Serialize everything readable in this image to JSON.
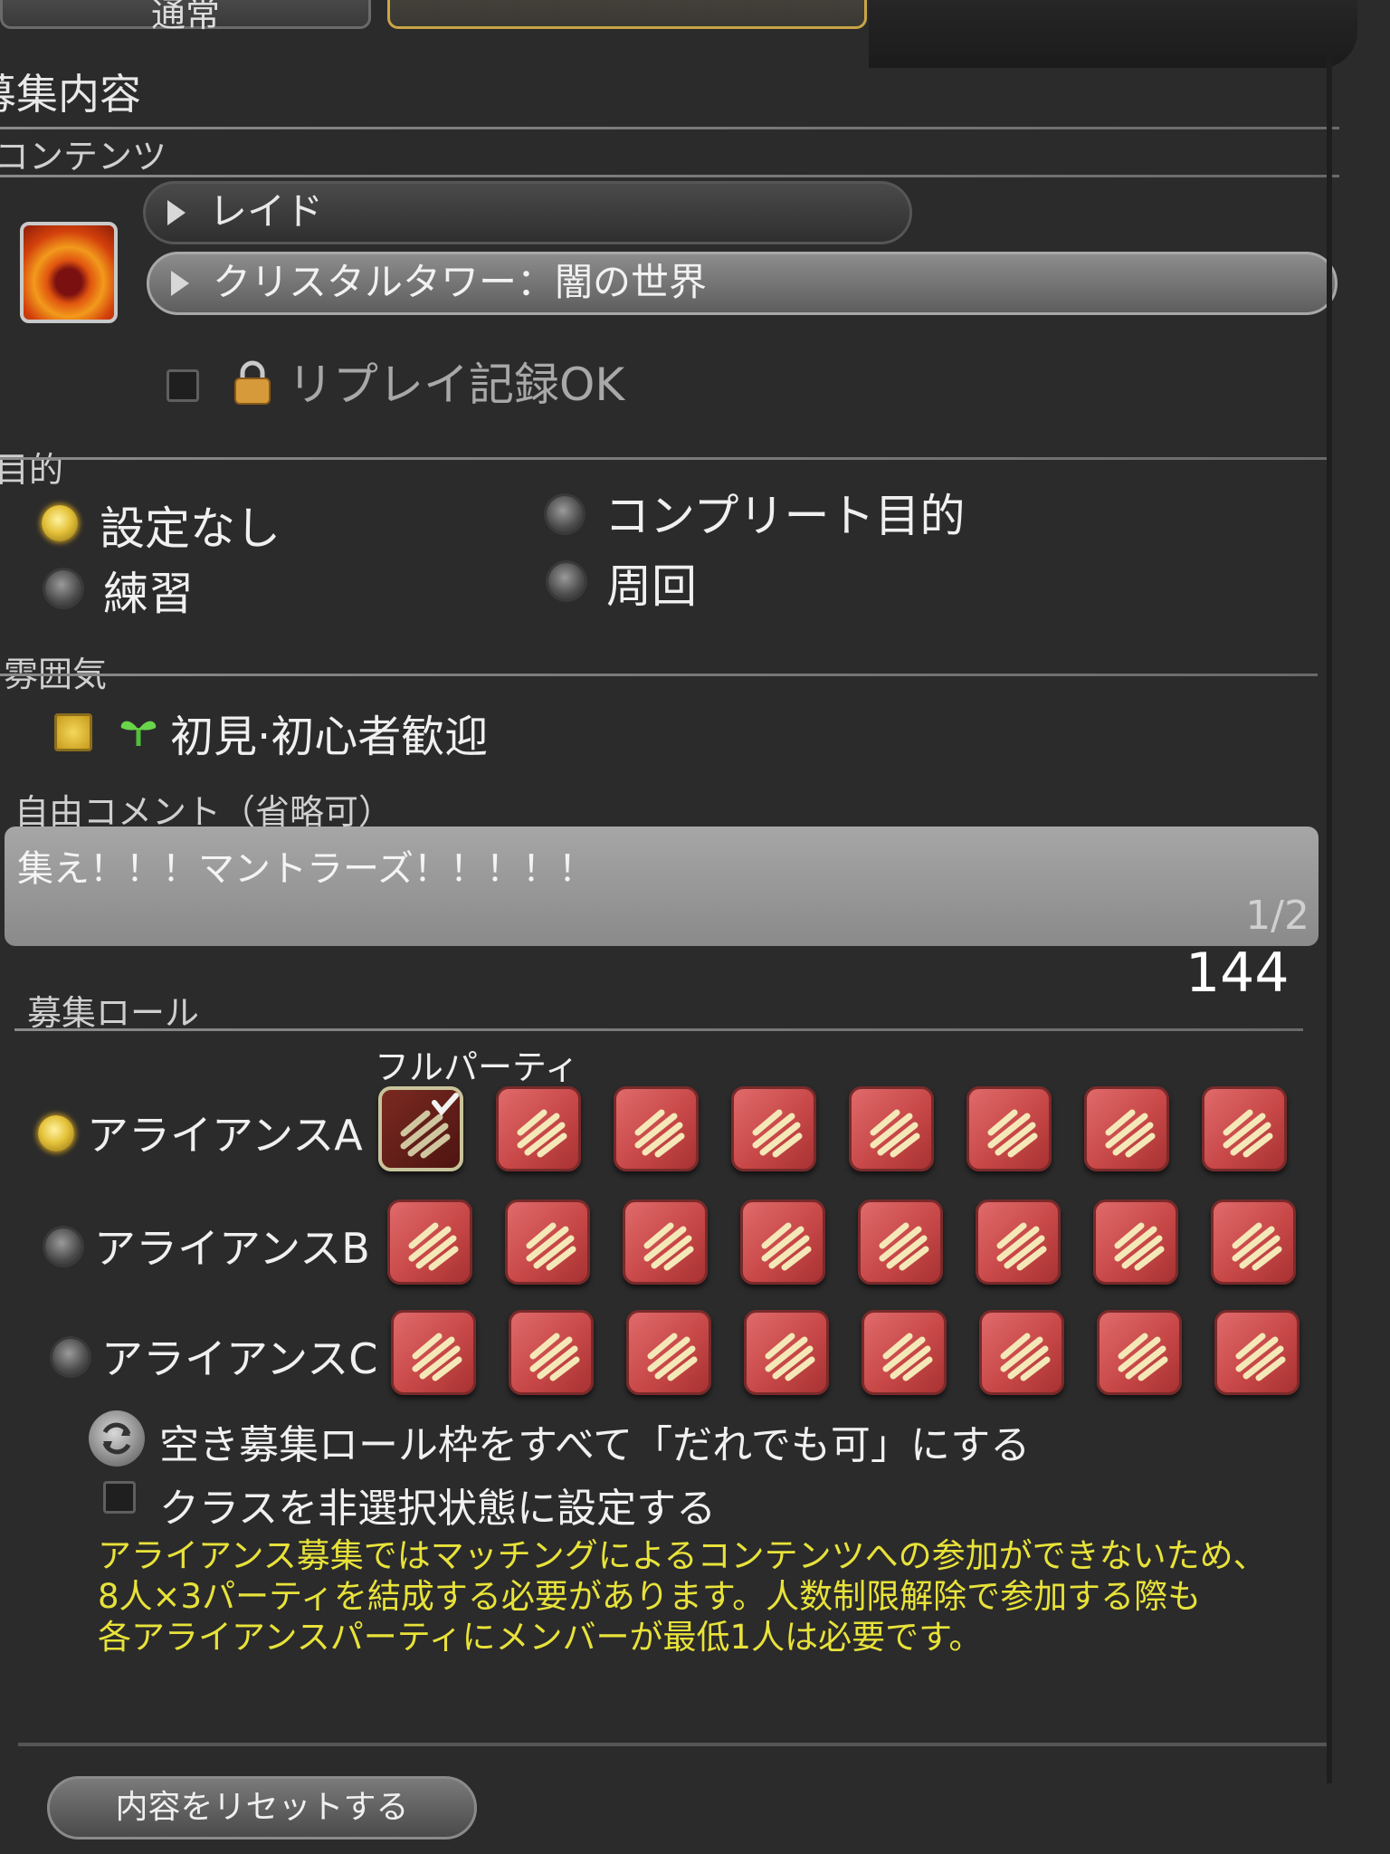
{
  "tabs": [
    {
      "label": "通常"
    },
    {
      "label": ""
    },
    {
      "label": ""
    }
  ],
  "recruitment_title": "募集内容",
  "content_section": {
    "label": "コンテンツ",
    "category": "レイド",
    "duty": "クリスタルタワー：闇の世界",
    "replay_label": "リプレイ記録OK",
    "replay_checked": false
  },
  "purpose_section": {
    "label": "目的",
    "options": [
      {
        "label": "設定なし",
        "selected": true
      },
      {
        "label": "コンプリート目的",
        "selected": false
      },
      {
        "label": "練習",
        "selected": false
      },
      {
        "label": "周回",
        "selected": false
      }
    ]
  },
  "atmosphere_section": {
    "label": "雰囲気",
    "option_label": "初見·初心者歓迎",
    "checked": true
  },
  "comment_section": {
    "label": "自由コメント（省略可）",
    "value": "集え！！！マントラーズ！！！！！",
    "page": "1/2",
    "remaining": "144"
  },
  "roles_section": {
    "label": "募集ロール",
    "full_party_label": "フルパーティ",
    "alliances": [
      {
        "label": "アライアンスA",
        "selected": true,
        "slots": 8,
        "full_party_checked": true
      },
      {
        "label": "アライアンスB",
        "selected": false,
        "slots": 8,
        "full_party_checked": false
      },
      {
        "label": "アライアンスC",
        "selected": false,
        "slots": 8,
        "full_party_checked": false
      }
    ],
    "set_anyone_label": "空き募集ロール枠をすべて「だれでも可」にする",
    "deselect_class_label": "クラスを非選択状態に設定する",
    "deselect_class_checked": false,
    "notice_lines": [
      "アライアンス募集ではマッチングによるコンテンツへの参加ができないため、",
      "8人×3パーティを結成する必要があります。人数制限解除で参加する際も",
      "各アライアンスパーティにメンバーが最低1人は必要です。"
    ]
  },
  "reset_label": "内容をリセットする",
  "colors": {
    "background": "#2b2b2b",
    "notice_text": "#e8e23a",
    "role_slot": "#c84848",
    "radio_on": "#e4c23a"
  }
}
